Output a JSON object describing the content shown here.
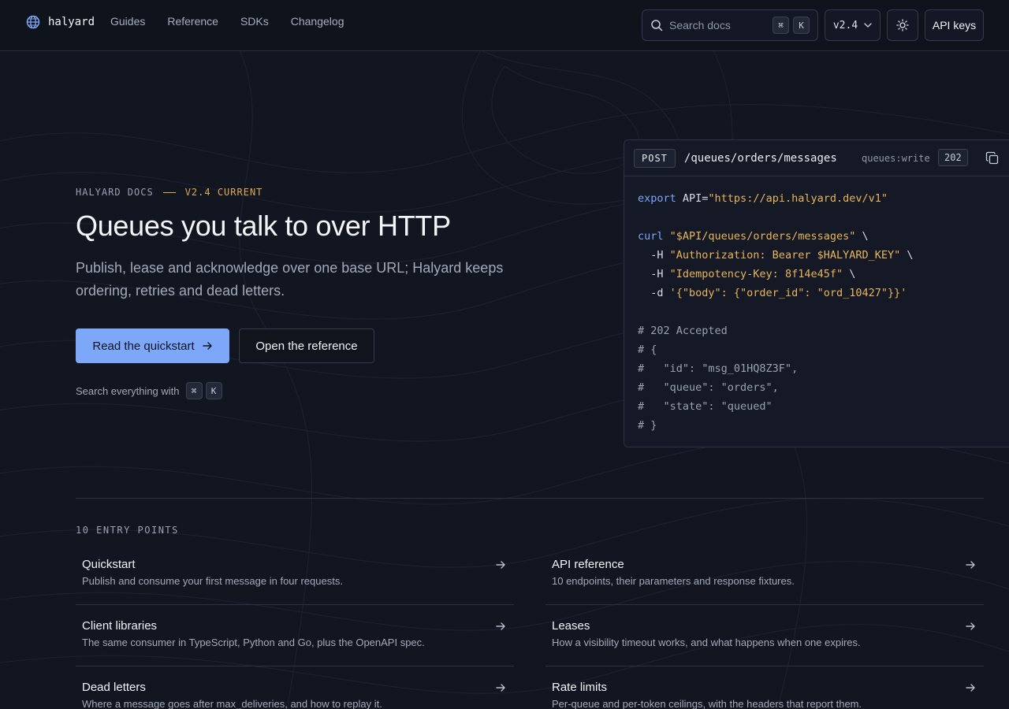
{
  "header": {
    "brand": "halyard",
    "nav": [
      "Guides",
      "Reference",
      "SDKs",
      "Changelog"
    ],
    "search_placeholder": "Search docs",
    "search_keys": [
      "⌘",
      "K"
    ],
    "version": "v2.4",
    "api_keys_label": "API keys"
  },
  "hero": {
    "eyebrow_docs": "HALYARD DOCS",
    "eyebrow_version": "V2.4 CURRENT",
    "title": "Queues you talk to over HTTP",
    "subtitle": "Publish, lease and acknowledge over one base URL; Halyard keeps ordering, retries and dead letters.",
    "primary_cta": "Read the quickstart",
    "secondary_cta": "Open the reference",
    "search_hint": "Search everything with",
    "search_keys": [
      "⌘",
      "K"
    ]
  },
  "code_panel": {
    "method": "POST",
    "endpoint": "/queues/orders/messages",
    "scope": "queues:write",
    "status": "202",
    "lines": [
      [
        [
          "kw",
          "export"
        ],
        [
          "t",
          " API="
        ],
        [
          "str",
          "\"https://api.halyard.dev/v1\""
        ]
      ],
      [],
      [
        [
          "kw",
          "curl"
        ],
        [
          "t",
          " "
        ],
        [
          "str",
          "\"$API/queues/orders/messages\""
        ],
        [
          "t",
          " \\"
        ]
      ],
      [
        [
          "t",
          "  -H "
        ],
        [
          "str",
          "\"Authorization: Bearer $HALYARD_KEY\""
        ],
        [
          "t",
          " \\"
        ]
      ],
      [
        [
          "t",
          "  -H "
        ],
        [
          "str",
          "\"Idempotency-Key: 8f14e45f\""
        ],
        [
          "t",
          " \\"
        ]
      ],
      [
        [
          "t",
          "  -d "
        ],
        [
          "str",
          "'{\"body\": {\"order_id\": \"ord_10427\"}}'"
        ]
      ],
      [],
      [
        [
          "cm",
          "# 202 Accepted"
        ]
      ],
      [
        [
          "cm",
          "# {"
        ]
      ],
      [
        [
          "cm",
          "#   \"id\": \"msg_01HQ8Z3F\","
        ]
      ],
      [
        [
          "cm",
          "#   \"queue\": \"orders\","
        ]
      ],
      [
        [
          "cm",
          "#   \"state\": \"queued\""
        ]
      ],
      [
        [
          "cm",
          "# }"
        ]
      ]
    ]
  },
  "entry_points": {
    "label": "10 ENTRY POINTS",
    "items": [
      {
        "title": "Quickstart",
        "desc": "Publish and consume your first message in four requests."
      },
      {
        "title": "API reference",
        "desc": "10 endpoints, their parameters and response fixtures."
      },
      {
        "title": "Client libraries",
        "desc": "The same consumer in TypeScript, Python and Go, plus the OpenAPI spec."
      },
      {
        "title": "Leases",
        "desc": "How a visibility timeout works, and what happens when one expires."
      },
      {
        "title": "Dead letters",
        "desc": "Where a message goes after max_deliveries, and how to replay it."
      },
      {
        "title": "Rate limits",
        "desc": "Per-queue and per-token ceilings, with the headers that report them."
      }
    ]
  },
  "colors": {
    "accent": "#7da7f9",
    "version_badge": "#e0a94a",
    "background": "#121621"
  }
}
